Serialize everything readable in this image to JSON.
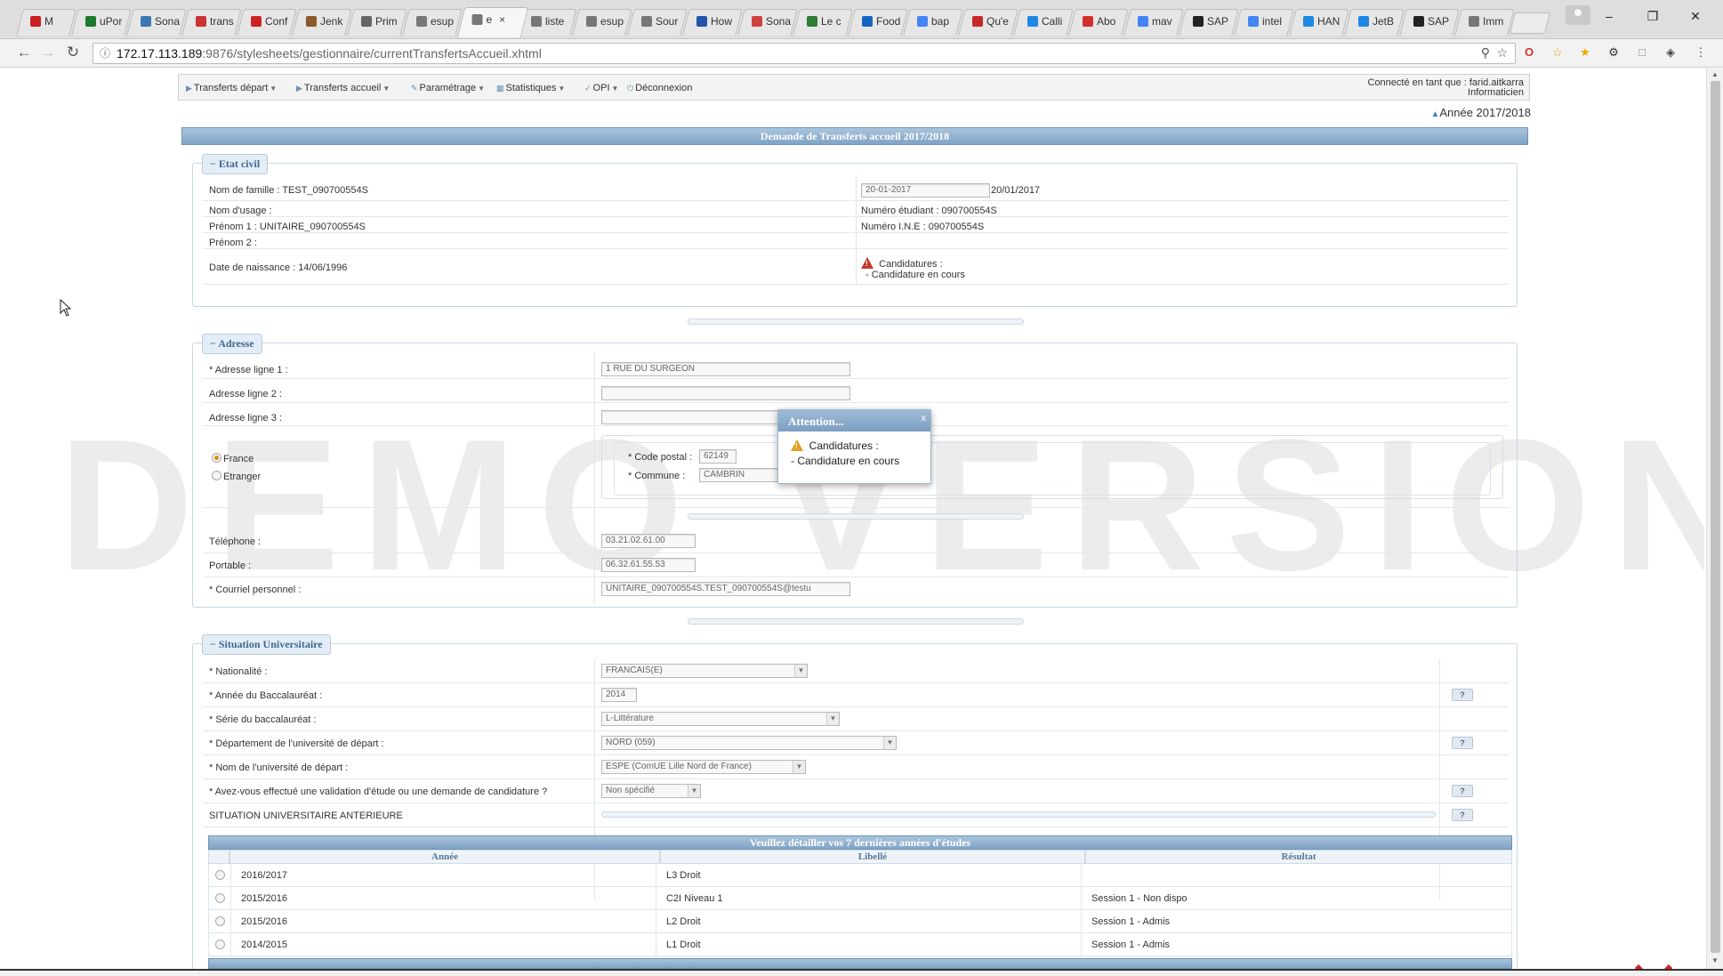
{
  "browser": {
    "tabs": [
      {
        "label": "M",
        "color": "#cc1f1f"
      },
      {
        "label": "uPor",
        "color": "#1c7a2c"
      },
      {
        "label": "Sona",
        "color": "#3d78b4"
      },
      {
        "label": "trans",
        "color": "#cc3333"
      },
      {
        "label": "Conf",
        "color": "#cc2222"
      },
      {
        "label": "Jenk",
        "color": "#8b5a2b"
      },
      {
        "label": "Prim",
        "color": "#666666"
      },
      {
        "label": "esup",
        "color": "#777777"
      },
      {
        "label": "e",
        "color": "#777777",
        "active": true
      },
      {
        "label": "liste",
        "color": "#777777"
      },
      {
        "label": "esup",
        "color": "#777777"
      },
      {
        "label": "Sour",
        "color": "#777777"
      },
      {
        "label": "How",
        "color": "#2255aa"
      },
      {
        "label": "Sona",
        "color": "#d04040"
      },
      {
        "label": "Le c",
        "color": "#2e7d32"
      },
      {
        "label": "Food",
        "color": "#1565c0"
      },
      {
        "label": "bap",
        "color": "#4285f4"
      },
      {
        "label": "Qu'e",
        "color": "#c62828"
      },
      {
        "label": "Calli",
        "color": "#1e88e5"
      },
      {
        "label": "Abo",
        "color": "#d32f2f"
      },
      {
        "label": "mav",
        "color": "#4285f4"
      },
      {
        "label": "SAP",
        "color": "#222222"
      },
      {
        "label": "intel",
        "color": "#4285f4"
      },
      {
        "label": "HAN",
        "color": "#1e88e5"
      },
      {
        "label": "JetB",
        "color": "#1e88e5"
      },
      {
        "label": "SAP",
        "color": "#222222"
      },
      {
        "label": "Imm",
        "color": "#777777"
      }
    ],
    "url_host": "172.17.113.189",
    "url_path": ":9876/stylesheets/gestionnaire/currentTransfertsAccueil.xhtml"
  },
  "menu": {
    "items": [
      "Transferts départ",
      "Transferts accueil",
      "Paramétrage",
      "Statistiques",
      "OPI",
      "Déconnexion"
    ],
    "user_line1": "Connecté en tant que : farid.aitkarra",
    "user_line2": "Informaticien",
    "year": "Année 2017/2018"
  },
  "page_title": "Demande de Transferts accueil 2017/2018",
  "watermark": "DEMO VERSION",
  "etat_civil": {
    "legend": "Etat civil",
    "nom_famille": "Nom de famille : TEST_090700554S",
    "nom_usage": "Nom d'usage :",
    "prenom1": "Prénom 1 : UNITAIRE_090700554S",
    "prenom2": "Prénom 2 :",
    "date_naissance": "Date de naissance : 14/06/1996",
    "date_field_value": "20-01-2017",
    "date_text": "20/01/2017",
    "numero_etudiant": "Numéro étudiant : 090700554S",
    "numero_ine": "Numéro I.N.E : 090700554S",
    "candidatures_label": "Candidatures :",
    "candidatures_value": "- Candidature en cours"
  },
  "adresse": {
    "legend": "Adresse",
    "ligne1_label": "* Adresse ligne 1 :",
    "ligne1_value": "1 RUE DU SURGEON",
    "ligne2_label": "Adresse ligne 2 :",
    "ligne2_value": "",
    "ligne3_label": "Adresse ligne 3 :",
    "ligne3_value": "",
    "pays_france": "France",
    "pays_etranger": "Etranger",
    "code_postal_label": "* Code postal :",
    "code_postal_value": "62149",
    "commune_label": "* Commune :",
    "commune_value": "CAMBRIN",
    "telephone_label": "Téléphone :",
    "telephone_value": "03.21.02.61.00",
    "portable_label": "Portable :",
    "portable_value": "06.32.61.55.53",
    "courriel_label": "* Courriel personnel :",
    "courriel_value": "UNITAIRE_090700554S.TEST_090700554S@testu"
  },
  "dialog": {
    "title": "Attention...",
    "close": "x",
    "line1": "Candidatures :",
    "line2": "- Candidature en cours"
  },
  "situation": {
    "legend": "Situation Universitaire",
    "nationalite_label": "* Nationalité :",
    "nationalite_value": "FRANCAIS(E)",
    "annee_bac_label": "* Année du Baccalauréat :",
    "annee_bac_value": "2014",
    "serie_bac_label": "* Série du baccalauréat :",
    "serie_bac_value": "L-Littérature",
    "departement_label": "* Département de l'université de départ :",
    "departement_value": "NORD (059)",
    "universite_label": "* Nom de l'université de départ :",
    "universite_value": "ESPE (ComUE Lille Nord de France)",
    "validation_label": "* Avez-vous effectué une validation d'étude ou une demande de candidature ?",
    "validation_value": "Non spécifié",
    "anterieure_label": "SITUATION UNIVERSITAIRE ANTERIEURE",
    "help": "?"
  },
  "studies": {
    "title": "Veuillez détailler vos 7 dernières années d'études",
    "columns": [
      "Année",
      "Libellé",
      "Résultat"
    ],
    "rows": [
      {
        "annee": "2016/2017",
        "libelle": "L3 Droit",
        "resultat": ""
      },
      {
        "annee": "2015/2016",
        "libelle": "C2I Niveau 1",
        "resultat": "Session 1 - Non dispo"
      },
      {
        "annee": "2015/2016",
        "libelle": "L2 Droit",
        "resultat": "Session 1 - Admis"
      },
      {
        "annee": "2014/2015",
        "libelle": "L1 Droit",
        "resultat": "Session 1 - Admis"
      }
    ]
  }
}
